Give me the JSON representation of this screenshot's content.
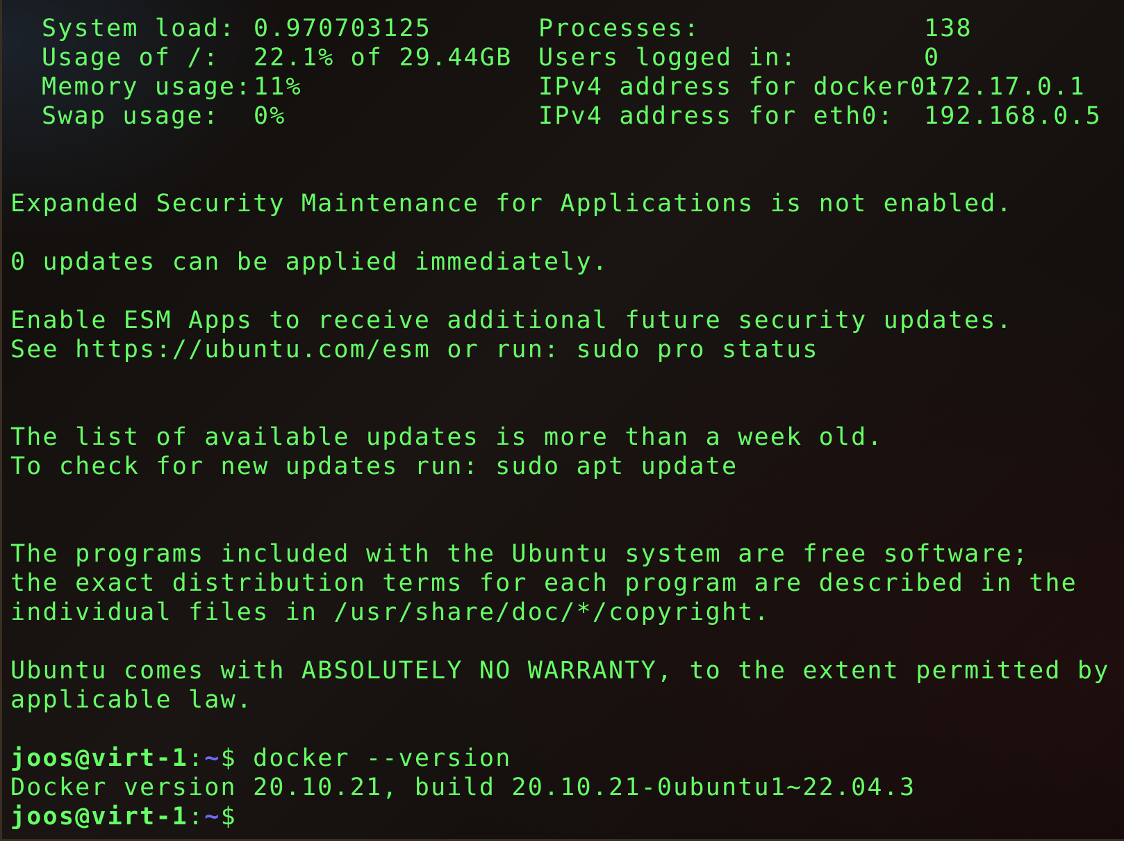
{
  "sysinfo": [
    {
      "label": "System load:",
      "value": "0.970703125",
      "label2": "Processes:",
      "value2": "138"
    },
    {
      "label": "Usage of /:",
      "value": "22.1% of 29.44GB",
      "label2": "Users logged in:",
      "value2": "0"
    },
    {
      "label": "Memory usage:",
      "value": "11%",
      "label2": "IPv4 address for docker0:",
      "value2": "172.17.0.1"
    },
    {
      "label": "Swap usage:",
      "value": "0%",
      "label2": "IPv4 address for eth0:",
      "value2": "192.168.0.5"
    }
  ],
  "messages": {
    "esm_status": "Expanded Security Maintenance for Applications is not enabled.",
    "updates": "0 updates can be applied immediately.",
    "esm_enable": "Enable ESM Apps to receive additional future security updates.",
    "esm_see": "See https://ubuntu.com/esm or run: sudo pro status",
    "list_old": "The list of available updates is more than a week old.",
    "check_updates": "To check for new updates run: sudo apt update",
    "free_sw_1": "The programs included with the Ubuntu system are free software;",
    "free_sw_2": "the exact distribution terms for each program are described in the",
    "free_sw_3": "individual files in /usr/share/doc/*/copyright.",
    "warranty_1": "Ubuntu comes with ABSOLUTELY NO WARRANTY, to the extent permitted by",
    "warranty_2": "applicable law."
  },
  "prompt": {
    "user_host": "joos@virt-1",
    "separator": ":",
    "path": "~",
    "sign": "$"
  },
  "commands": [
    {
      "input": " docker --version",
      "output": "Docker version 20.10.21, build 20.10.21-0ubuntu1~22.04.3"
    }
  ],
  "colors": {
    "text": "#66ff66",
    "path": "#6b6bff",
    "background": "#0d0a09"
  }
}
